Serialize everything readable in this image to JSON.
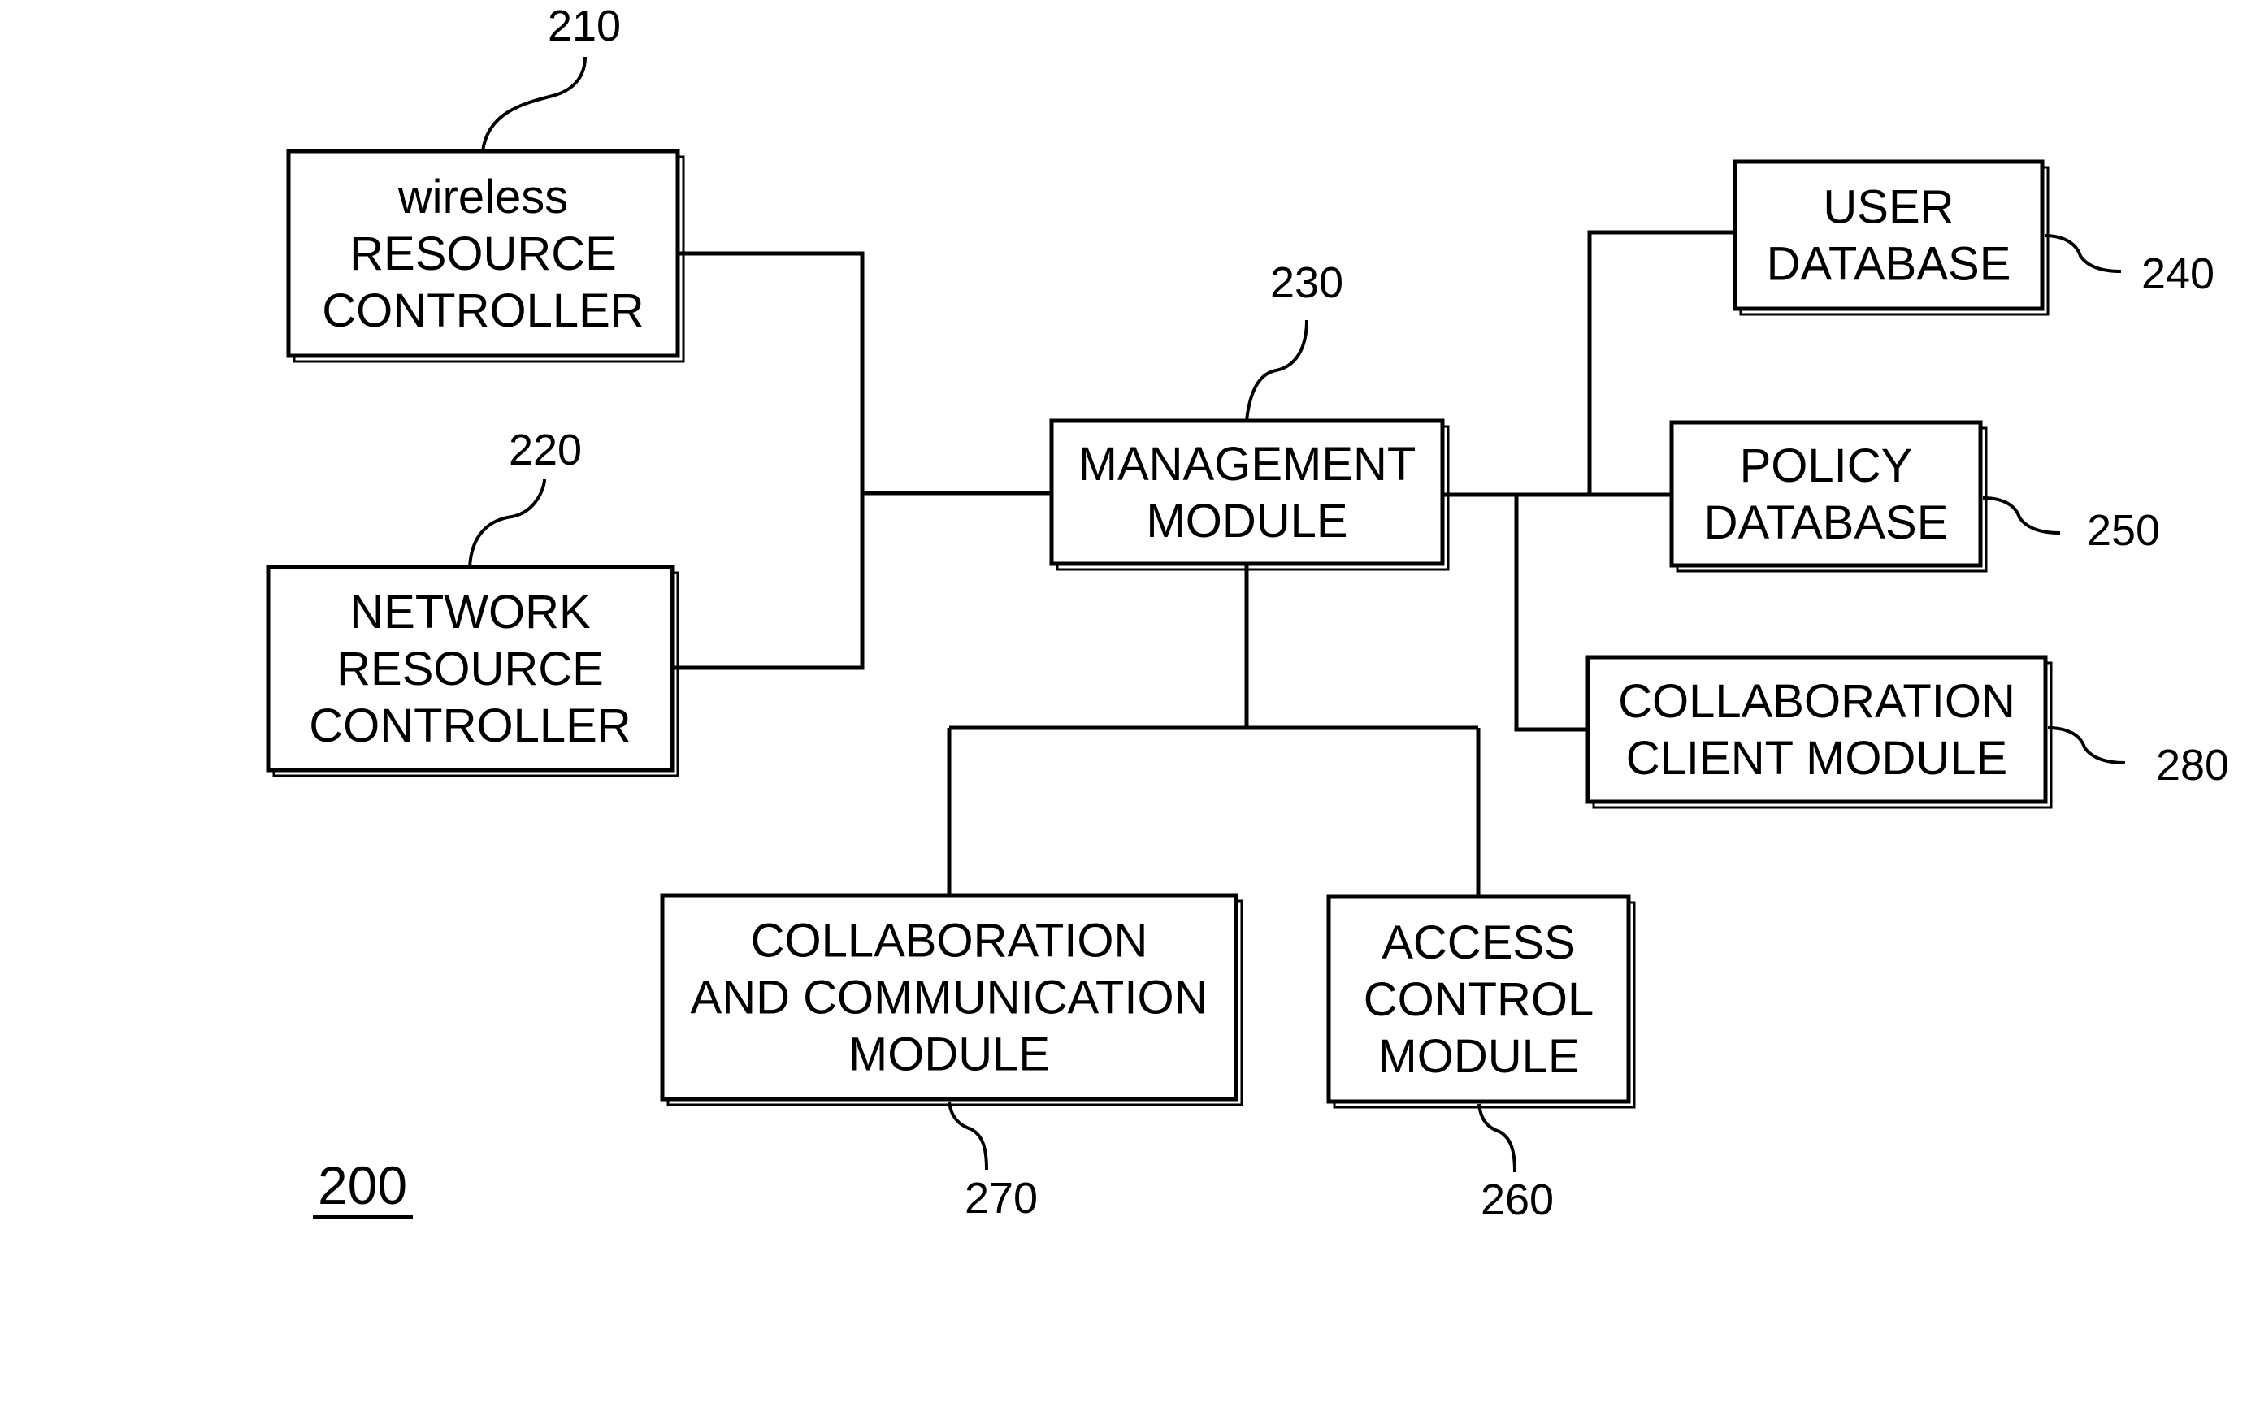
{
  "figure": {
    "number": "200",
    "blocks": [
      {
        "id": "wireless",
        "ref": "210",
        "lines": [
          "wireless",
          "RESOURCE",
          "CONTROLLER"
        ]
      },
      {
        "id": "network",
        "ref": "220",
        "lines": [
          "NETWORK",
          "RESOURCE",
          "CONTROLLER"
        ]
      },
      {
        "id": "management",
        "ref": "230",
        "lines": [
          "MANAGEMENT",
          "MODULE"
        ]
      },
      {
        "id": "user-db",
        "ref": "240",
        "lines": [
          "USER",
          "DATABASE"
        ]
      },
      {
        "id": "policy-db",
        "ref": "250",
        "lines": [
          "POLICY",
          "DATABASE"
        ]
      },
      {
        "id": "collab-client",
        "ref": "280",
        "lines": [
          "COLLABORATION",
          "CLIENT MODULE"
        ]
      },
      {
        "id": "collab-comm",
        "ref": "270",
        "lines": [
          "COLLABORATION",
          "AND COMMUNICATION",
          "MODULE"
        ]
      },
      {
        "id": "access-control",
        "ref": "260",
        "lines": [
          "ACCESS",
          "CONTROL",
          "MODULE"
        ]
      }
    ],
    "connections": [
      [
        "wireless",
        "management"
      ],
      [
        "network",
        "management"
      ],
      [
        "management",
        "user-db"
      ],
      [
        "management",
        "policy-db"
      ],
      [
        "management",
        "collab-client"
      ],
      [
        "management",
        "collab-comm"
      ],
      [
        "management",
        "access-control"
      ]
    ]
  }
}
